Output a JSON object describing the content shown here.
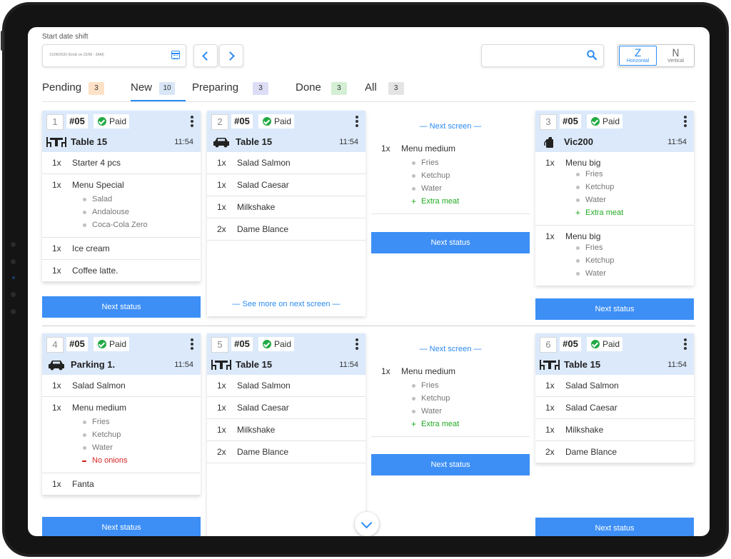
{
  "header": {
    "start_label": "Start date shift",
    "date_value": "21/06/2020 (Ends on 22/06 - 3AM)"
  },
  "layout_toggle": {
    "horizontal": "Horizontal",
    "vertical": "Vertical"
  },
  "tabs": [
    {
      "label": "Pending",
      "count": "3",
      "color": "#fde1c6"
    },
    {
      "label": "New",
      "count": "10",
      "color": "#d9e6f7"
    },
    {
      "label": "Preparing",
      "count": "3",
      "color": "#ddddf6"
    },
    {
      "label": "Done",
      "count": "3",
      "color": "#d4efd4"
    },
    {
      "label": "All",
      "count": "3",
      "color": "#e4e4e4"
    }
  ],
  "labels": {
    "paid": "Paid",
    "next_status": "Next status",
    "next_screen": "— Next screen —",
    "see_more": "— See more on next screen —"
  },
  "cards": {
    "c1": {
      "num": "1",
      "order": "#05",
      "place": "Table 15",
      "time": "11:54",
      "items": [
        {
          "qty": "1x",
          "name": "Starter 4 pcs"
        },
        {
          "qty": "1x",
          "name": "Menu Special",
          "mods": [
            "Salad",
            "Andalouse",
            "Coca-Cola Zero"
          ]
        },
        {
          "qty": "1x",
          "name": "Ice cream"
        },
        {
          "qty": "1x",
          "name": "Coffee latte."
        }
      ]
    },
    "c2": {
      "num": "2",
      "order": "#05",
      "place": "Table 15",
      "time": "11:54",
      "items": [
        {
          "qty": "1x",
          "name": "Salad Salmon"
        },
        {
          "qty": "1x",
          "name": "Salad Caesar"
        },
        {
          "qty": "1x",
          "name": "Milkshake"
        },
        {
          "qty": "2x",
          "name": "Dame Blance"
        }
      ]
    },
    "c2b": {
      "items": [
        {
          "qty": "1x",
          "name": "Menu medium",
          "mods": [
            "Fries",
            "Ketchup",
            "Water"
          ],
          "extra": "Extra meat"
        }
      ]
    },
    "c3": {
      "num": "3",
      "order": "#05",
      "place": "Vic200",
      "time": "11:54",
      "items": [
        {
          "qty": "1x",
          "name": "Menu big",
          "mods": [
            "Fries",
            "Ketchup",
            "Water"
          ],
          "extra": "Extra meat"
        },
        {
          "qty": "1x",
          "name": "Menu big",
          "mods": [
            "Fries",
            "Ketchup",
            "Water"
          ]
        }
      ]
    },
    "c4": {
      "num": "4",
      "order": "#05",
      "place": "Parking 1.",
      "time": "11:54",
      "items": [
        {
          "qty": "1x",
          "name": "Salad Salmon"
        },
        {
          "qty": "1x",
          "name": "Menu medium",
          "mods": [
            "Fries",
            "Ketchup",
            "Water"
          ],
          "minus": "No onions"
        },
        {
          "qty": "1x",
          "name": "Fanta"
        }
      ]
    },
    "c5": {
      "num": "5",
      "order": "#05",
      "place": "Table 15",
      "time": "11:54",
      "items": [
        {
          "qty": "1x",
          "name": "Salad Salmon"
        },
        {
          "qty": "1x",
          "name": "Salad Caesar"
        },
        {
          "qty": "1x",
          "name": "Milkshake"
        },
        {
          "qty": "2x",
          "name": "Dame Blance"
        }
      ]
    },
    "c5b": {
      "items": [
        {
          "qty": "1x",
          "name": "Menu medium",
          "mods": [
            "Fries",
            "Ketchup",
            "Water"
          ],
          "extra": "Extra meat"
        }
      ]
    },
    "c6": {
      "num": "6",
      "order": "#05",
      "place": "Table 15",
      "time": "11:54",
      "items": [
        {
          "qty": "1x",
          "name": "Salad Salmon"
        },
        {
          "qty": "1x",
          "name": "Salad Caesar"
        },
        {
          "qty": "1x",
          "name": "Milkshake"
        },
        {
          "qty": "2x",
          "name": "Dame Blance"
        }
      ]
    }
  },
  "accent_color": "#3d8ff5"
}
